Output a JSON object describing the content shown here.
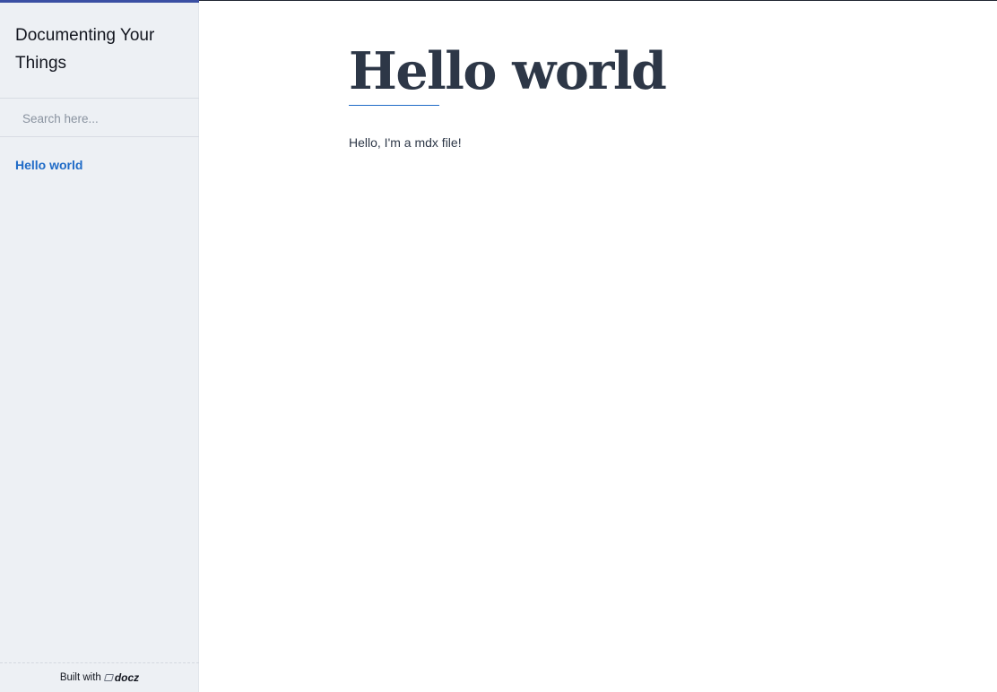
{
  "sidebar": {
    "title": "Documenting Your Things",
    "search": {
      "placeholder": "Search here...",
      "value": ""
    },
    "items": [
      {
        "label": "Hello world",
        "active": true
      }
    ],
    "footer": {
      "built_with": "Built with",
      "brand": "docz"
    }
  },
  "main": {
    "title": "Hello world",
    "body": "Hello, I'm a mdx file!"
  },
  "colors": {
    "sidebar_bg": "#edf0f4",
    "accent": "#1f6bc7",
    "top_bar": "#3a4fa3",
    "text": "#2d3747"
  }
}
